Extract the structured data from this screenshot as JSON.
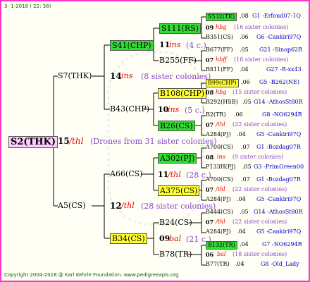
{
  "header": "3-  1-2018 ( 22: 38)",
  "footer": "Copyright 2004-2018 @ Karl Kehrle Foundation.   www.pedigreeapis.org",
  "root": {
    "name": "S2(THK)",
    "num": "15",
    "ins": "/thl",
    "desc": "(Drones from 31 sister colonies)"
  },
  "father": {
    "name": "S7(THK)",
    "num": "14",
    "ins": "ins",
    "desc": "(8 sister colonies)"
  },
  "mother": {
    "name": "A5(CS)",
    "num": "12",
    "ins": "/thl",
    "desc": "(28 sister colonies)"
  },
  "ff": {
    "name": "S41(CHP)",
    "num": "11",
    "ins": "ins",
    "desc": "(4 c.)"
  },
  "fm": {
    "name": "B43(CHP)",
    "num": "10",
    "ins": "ins",
    "desc": "(5 c.)"
  },
  "mf": {
    "name": "A66(CS)",
    "num": "11",
    "ins": "/thl",
    "desc": "(28 c.)"
  },
  "mm": {
    "name": "B34(CS)",
    "num": "09",
    "ins": "bal",
    "desc": "(21 c.)"
  },
  "fff": {
    "name": "S111(RS)",
    "num": "09",
    "ins": "hbg",
    "desc": "(16 sister colonies)"
  },
  "ffm": {
    "name": "B255(FF)",
    "num": "07",
    "ins": "hbff",
    "desc": "(16 sister colonies)"
  },
  "fmf": {
    "name": "B108(CHP)",
    "num": "08",
    "ins": "hbg",
    "desc": "(15 sister colonies)"
  },
  "fmm": {
    "name": "B26(CS)",
    "num": "07",
    "ins": "/thl",
    "desc": "(22 sister colonies)"
  },
  "mff": {
    "name": "A302(PJ)",
    "num": "08",
    "ins": "ins",
    "desc": "(9 sister colonies)"
  },
  "mfm": {
    "name": "A375(CS)",
    "num": "07",
    "ins": "/thl",
    "desc": "(22 sister colonies)"
  },
  "mmf": {
    "name": "B24(CS)",
    "num": "07",
    "ins": "/thl",
    "desc": "(22 sister colonies)"
  },
  "mmm": {
    "name": "B78(TR)",
    "num": "06",
    "ins": "bal",
    "desc": "(18 sister colonies)"
  },
  "leaves": [
    {
      "name": "S532(TK)",
      "val": ".08",
      "info": "G1 -Erfoud07-1Q"
    },
    {
      "name": "B351(CS)",
      "val": ".06",
      "info": "G6 -Cankiri97Q"
    },
    {
      "name": "B677(FF)",
      "val": ".05",
      "info": "G21 -Sinop62R"
    },
    {
      "name": "B811(FF)",
      "val": ".04",
      "info": "G27 -B-xx43"
    },
    {
      "name": "B99(CHP)",
      "val": ".06",
      "info": "G5 -B262(NE)"
    },
    {
      "name": "B292(HSB)",
      "val": ".05",
      "info": "G14 -AthosSt80R"
    },
    {
      "name": "B2(TR)",
      "val": ".06",
      "info": "G8 -NO6294R"
    },
    {
      "name": "A284(PJ)",
      "val": ".04",
      "info": "G5 -Cankiri97Q"
    },
    {
      "name": "A700(CS)",
      "val": ".07",
      "info": "G1 -Bozdag07R"
    },
    {
      "name": "P133H(PJ)",
      "val": ".05",
      "info": "G3 -PrimGreen00"
    },
    {
      "name": "A700(CS)",
      "val": ".07",
      "info": "G1 -Bozdag07R"
    },
    {
      "name": "A284(PJ)",
      "val": ".04",
      "info": "G5 -Cankiri97Q"
    },
    {
      "name": "B444(CS)",
      "val": ".05",
      "info": "G14 -AthosSt80R"
    },
    {
      "name": "A284(PJ)",
      "val": ".04",
      "info": "G5 -Cankiri97Q"
    },
    {
      "name": "B132(TR)",
      "val": ".04",
      "info": "G7 -NO6294R"
    },
    {
      "name": "B77(TR)",
      "val": ".04",
      "info": "G8 -Old_Lady"
    }
  ]
}
